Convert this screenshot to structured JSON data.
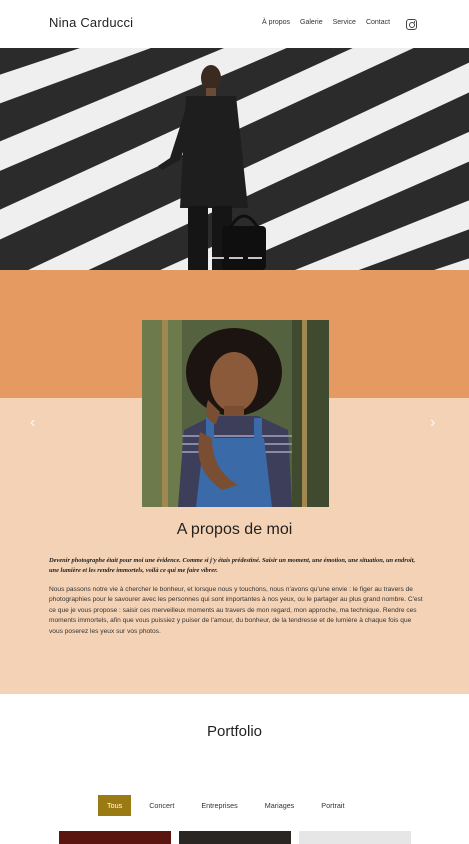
{
  "header": {
    "brand": "Nina Carducci",
    "nav": [
      {
        "label": "À propos"
      },
      {
        "label": "Galerie"
      },
      {
        "label": "Service"
      },
      {
        "label": "Contact"
      }
    ],
    "social_icon": "instagram-icon"
  },
  "hero": {
    "slides_count": 3,
    "prev_arrow": "‹",
    "next_arrow": "›"
  },
  "about": {
    "title": "A propos de moi",
    "quote": "Devenir photographe était pour moi une évidence. Comme si j'y étais prédestiné. Saisir un moment, une émotion, une situation, un endroit, une lumière et les rendre immortels, voilà ce qui me faire vibrer.",
    "body": "Nous passons notre vie à chercher le bonheur, et lorsque nous y touchons, nous n'avons qu'une envie : le figer au travers de photographies pour le savourer avec les personnes qui sont importantes à nos yeux, ou le partager au plus grand nombre. C'est ce que je vous propose : saisir ces merveilleux moments au travers de mon regard, mon approche, ma technique. Rendre ces moments immortels, afin que vous puissiez y puiser de l'amour, du bonheur, de la tendresse et de lumière à chaque fois que vous poserez les yeux sur vos photos."
  },
  "portfolio": {
    "title": "Portfolio",
    "filters": [
      {
        "label": "Tous",
        "active": true
      },
      {
        "label": "Concert",
        "active": false
      },
      {
        "label": "Entreprises",
        "active": false
      },
      {
        "label": "Mariages",
        "active": false
      },
      {
        "label": "Portrait",
        "active": false
      }
    ]
  },
  "colors": {
    "accent": "#9a7a12",
    "about_top": "#e59a62",
    "about_bottom": "#f4d2b5"
  }
}
